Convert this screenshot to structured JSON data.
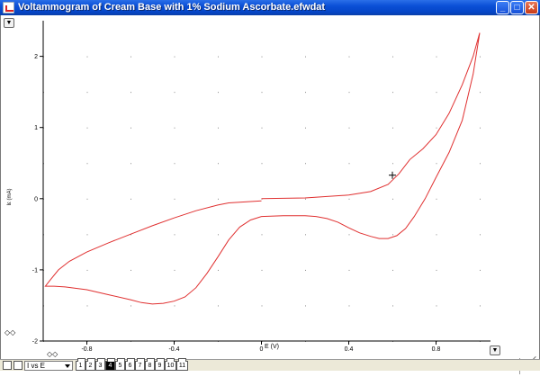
{
  "window": {
    "title": "Voltammogram of Cream Base with 1% Sodium Ascorbate.efwdat",
    "controls": [
      "_",
      "□",
      "✕"
    ]
  },
  "toolbar": {
    "menu_glyph": "▼",
    "scroll_glyph": "◇◇",
    "scroll_glyph_v": "◇◇",
    "dropdown_glyph": "▼"
  },
  "chart_data": {
    "type": "line",
    "xlabel": "E (V)",
    "ylabel": "Iε (mA)",
    "xlim": [
      -1.0,
      1.0
    ],
    "ylim": [
      -2.0,
      2.45
    ],
    "xticks": [
      -0.8,
      -0.4,
      0,
      0.4,
      0.8
    ],
    "xtick_labels": [
      "-0.8",
      "-0.4",
      "0",
      "0.4",
      "0.8"
    ],
    "yticks": [
      -2,
      -1,
      0,
      1,
      2
    ],
    "ytick_labels": [
      "-2",
      "-1",
      "0",
      "1",
      "2"
    ],
    "grid": "dots",
    "series": [
      {
        "color": "#e03030",
        "x": [
          0.0,
          0.2,
          0.4,
          0.5,
          0.58,
          0.63,
          0.68,
          0.74,
          0.8,
          0.86,
          0.92,
          0.97,
          1.0,
          0.97,
          0.92,
          0.86,
          0.8,
          0.75,
          0.7,
          0.66,
          0.62,
          0.58,
          0.54,
          0.5,
          0.45,
          0.4,
          0.35,
          0.3,
          0.25,
          0.2,
          0.1,
          0.0,
          -0.05,
          -0.1,
          -0.15,
          -0.2,
          -0.25,
          -0.3,
          -0.35,
          -0.4,
          -0.45,
          -0.5,
          -0.55,
          -0.6,
          -0.7,
          -0.8,
          -0.9,
          -0.95,
          -0.99,
          -0.97,
          -0.93,
          -0.88,
          -0.8,
          -0.7,
          -0.6,
          -0.5,
          -0.4,
          -0.3,
          -0.2,
          -0.15,
          -0.1,
          -0.05,
          0.0
        ],
        "y": [
          0.0,
          0.01,
          0.05,
          0.1,
          0.2,
          0.35,
          0.55,
          0.7,
          0.9,
          1.2,
          1.6,
          2.0,
          2.33,
          1.75,
          1.1,
          0.65,
          0.3,
          0.0,
          -0.25,
          -0.42,
          -0.52,
          -0.56,
          -0.56,
          -0.53,
          -0.48,
          -0.41,
          -0.33,
          -0.28,
          -0.25,
          -0.24,
          -0.24,
          -0.25,
          -0.3,
          -0.4,
          -0.58,
          -0.82,
          -1.05,
          -1.25,
          -1.38,
          -1.44,
          -1.47,
          -1.48,
          -1.46,
          -1.42,
          -1.35,
          -1.28,
          -1.24,
          -1.23,
          -1.23,
          -1.15,
          -1.0,
          -0.88,
          -0.75,
          -0.62,
          -0.5,
          -0.38,
          -0.27,
          -0.17,
          -0.09,
          -0.06,
          -0.05,
          -0.04,
          -0.03
        ]
      }
    ],
    "marker": {
      "x": 0.6,
      "y": 0.33,
      "symbol": "+"
    }
  },
  "statusbar": {
    "view_select": "I vs E",
    "tabs": [
      "1",
      "2",
      "3",
      "4",
      "5",
      "6",
      "7",
      "8",
      "9",
      "10",
      "11"
    ],
    "active_tab": "4"
  }
}
